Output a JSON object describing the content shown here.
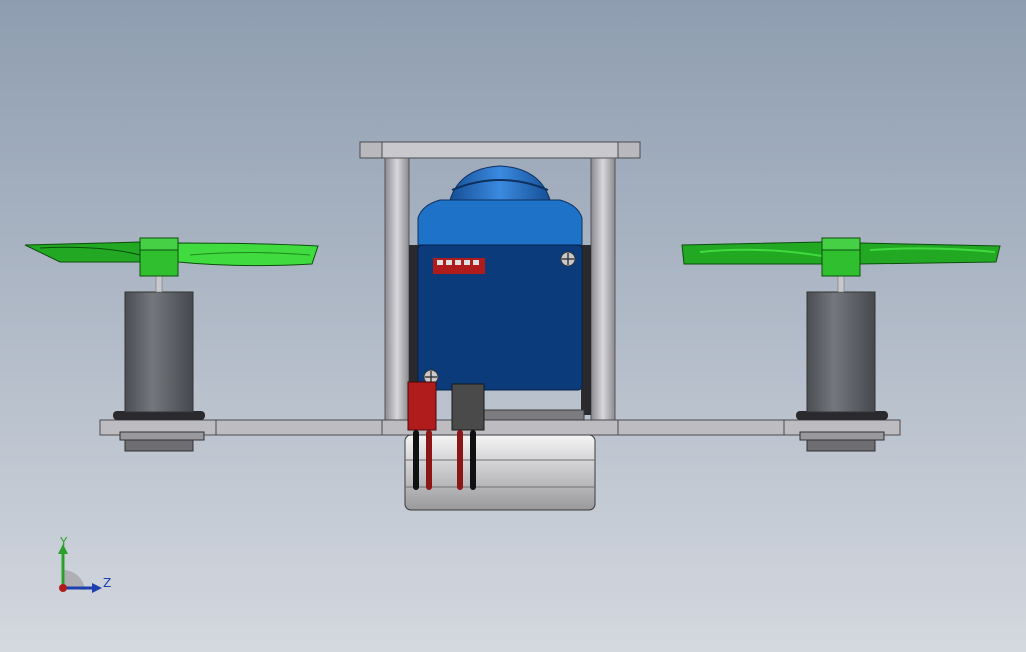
{
  "viewport": {
    "background_top": "#8e9db0",
    "background_bottom": "#d4d8df"
  },
  "model": {
    "colors": {
      "frame": "#a9a9ad",
      "frame_dark": "#6d6d72",
      "motor": "#5d6166",
      "propeller": "#22a822",
      "propeller_light": "#3fdb3f",
      "camera_body": "#0b3b7a",
      "camera_lens": "#1e73c8",
      "connector_red": "#b01c1c",
      "connector_gray": "#4a4a4a",
      "battery": "#c7c7c9"
    }
  },
  "triad": {
    "y_label": "Y",
    "z_label": "Z",
    "y_color": "#2aa02a",
    "z_color": "#1e3fb0",
    "origin_color": "#b01c1c"
  }
}
